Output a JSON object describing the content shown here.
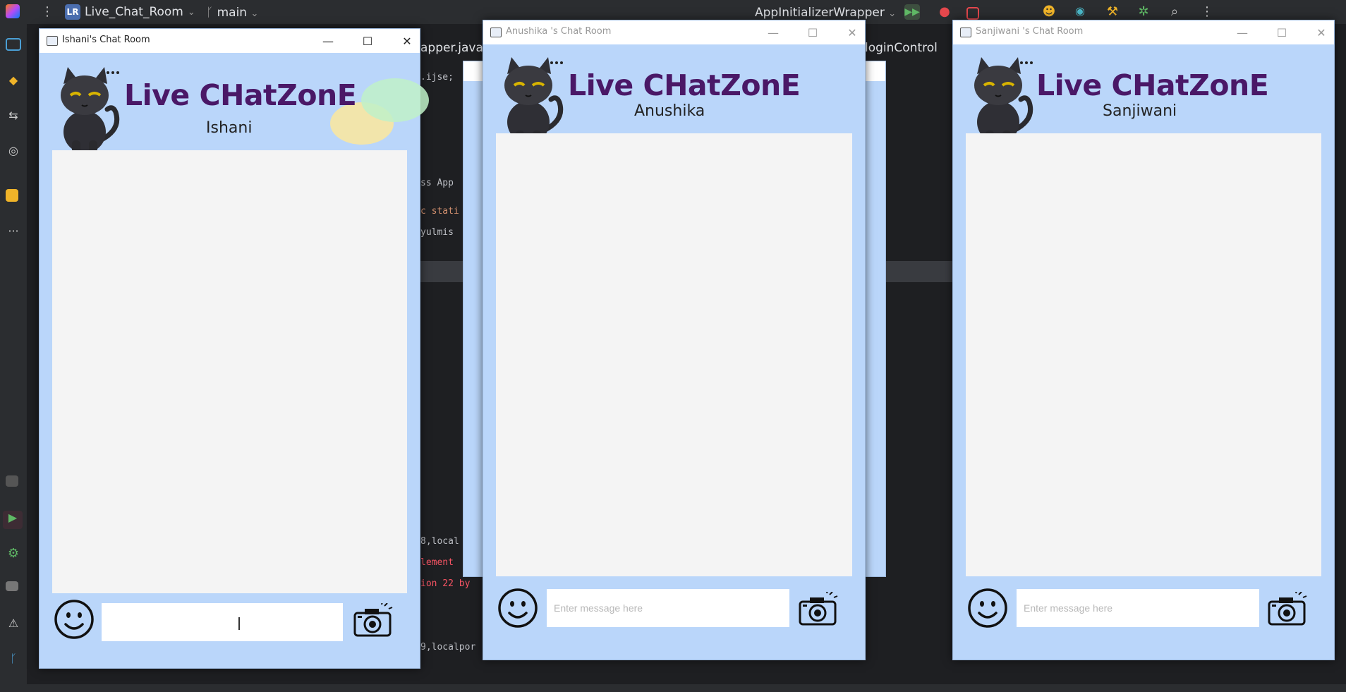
{
  "ide": {
    "project_badge": "LR",
    "project_name": "Live_Chat_Room",
    "branch": "main",
    "run_config": "AppInitializerWrapper",
    "editor_tabs": [
      "apper.java",
      "loginControl"
    ],
    "code_fragments": [
      ".ijse;",
      "8,local",
      "lement",
      "ion 22 by",
      "9,localpor",
      "ss App",
      "c stati",
      "yulmis"
    ]
  },
  "windows": [
    {
      "title": "Ishani's Chat Room",
      "brand": "Live CHatZonE",
      "user": "Ishani",
      "input_placeholder": "",
      "input_value": ""
    },
    {
      "title": "Anushika 's Chat Room",
      "brand": "Live CHatZonE",
      "user": "Anushika",
      "input_placeholder": "Enter message here",
      "input_value": ""
    },
    {
      "title": "Sanjiwani 's Chat Room",
      "brand": "Live CHatZonE",
      "user": "Sanjiwani",
      "input_placeholder": "Enter message here",
      "input_value": ""
    }
  ],
  "colors": {
    "window_bg": "#bad6fa",
    "brand_text": "#4a1867",
    "chat_area": "#f4f4f4",
    "ide_bg": "#1e1f22"
  },
  "icons": {
    "emoji": "smiley-face-icon",
    "camera": "camera-icon",
    "minimize": "minimize-icon",
    "maximize": "maximize-icon",
    "close": "close-icon"
  }
}
